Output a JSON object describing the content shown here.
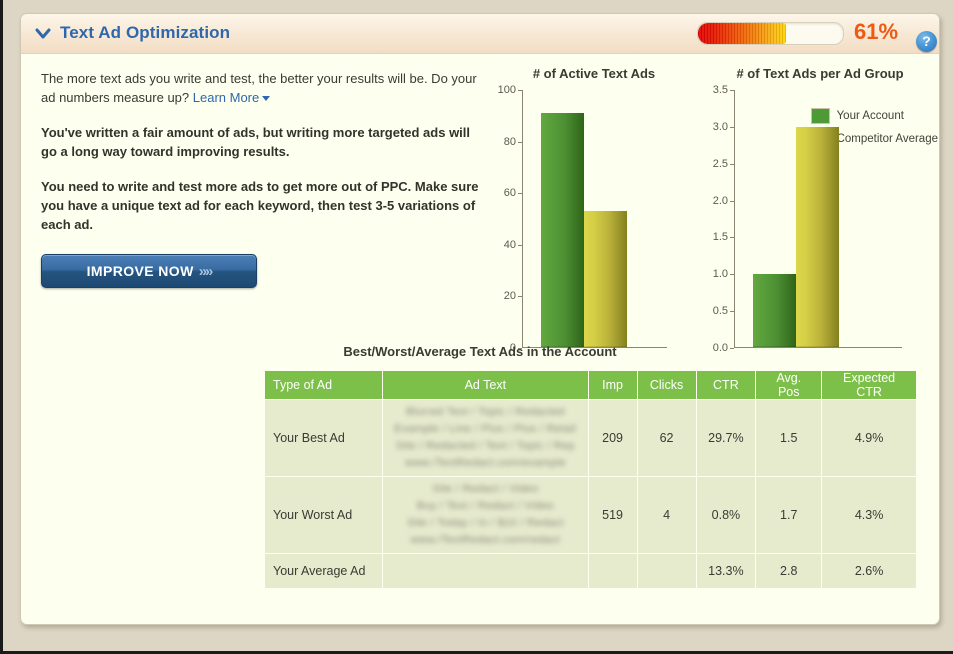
{
  "header": {
    "title": "Text Ad Optimization",
    "progress_value": 61,
    "progress_label": "61%",
    "help_glyph": "?",
    "collapse_icon": "chevron-down-icon"
  },
  "intro": {
    "text_before_link": "The more text ads you write and test, the better your results will be. Do your ad numbers measure up? ",
    "link_label": "Learn More"
  },
  "advice": {
    "paragraph_1": "You've written a fair amount of ads, but writing more targeted ads will go a long way toward improving results.",
    "paragraph_2": "You need to write and test more ads to get more out of PPC. Make sure you have a unique text ad for each keyword, then test 3-5 variations of each ad."
  },
  "cta": {
    "label": "IMPROVE NOW",
    "arrows": "»»"
  },
  "legend": {
    "your_account": "Your Account",
    "competitor_average": "Competitor Average",
    "your_account_color": "#4e9a36",
    "competitor_average_color": "#e6e13c"
  },
  "table": {
    "title": "Best/Worst/Average Text Ads in the Account",
    "columns": [
      "Type of Ad",
      "Ad Text",
      "Imp",
      "Clicks",
      "CTR",
      "Avg. Pos",
      "Expected CTR"
    ],
    "rows": [
      {
        "type": "Your Best Ad",
        "ad_text": "Blurred Text / Topic / Redacted\nExample / Line / Plus / Plus / Retail\nSite / Redacted / Text / Topic / Rep\nwww./TextRedact.com/example",
        "imp": "209",
        "clicks": "62",
        "ctr": "29.7%",
        "avg_pos": "1.5",
        "expected_ctr": "4.9%"
      },
      {
        "type": "Your Worst Ad",
        "ad_text": "Site / Redact / Video\nBuy / Text / Redact / Video\nSite / Today / In / $10 / Redact\nwww./TextRedact.com/redact",
        "imp": "519",
        "clicks": "4",
        "ctr": "0.8%",
        "avg_pos": "1.7",
        "expected_ctr": "4.3%"
      },
      {
        "type": "Your Average Ad",
        "ad_text": "",
        "imp": "",
        "clicks": "",
        "ctr": "13.3%",
        "avg_pos": "2.8",
        "expected_ctr": "2.6%"
      }
    ]
  },
  "chart_data": [
    {
      "type": "bar",
      "title": "# of Active Text Ads",
      "categories": [
        "Your Account",
        "Competitor Average"
      ],
      "values": [
        91,
        53
      ],
      "series": [
        {
          "name": "Your Account",
          "values": [
            91
          ],
          "color": "#4e9a36"
        },
        {
          "name": "Competitor Average",
          "values": [
            53
          ],
          "color": "#c9c23f"
        }
      ],
      "xlabel": "",
      "ylabel": "",
      "ylim": [
        0,
        100
      ],
      "yticks": [
        0,
        20,
        40,
        60,
        80,
        100
      ],
      "ytick_labels": [
        "0",
        "20",
        "40",
        "60",
        "80",
        "100"
      ],
      "grid": false,
      "legend": "none"
    },
    {
      "type": "bar",
      "title": "# of Text Ads per Ad Group",
      "categories": [
        "Your Account",
        "Competitor Average"
      ],
      "values": [
        1.0,
        3.0
      ],
      "series": [
        {
          "name": "Your Account",
          "values": [
            1.0
          ],
          "color": "#4e9a36"
        },
        {
          "name": "Competitor Average",
          "values": [
            3.0
          ],
          "color": "#c9c23f"
        }
      ],
      "xlabel": "",
      "ylabel": "",
      "ylim": [
        0,
        3.5
      ],
      "yticks": [
        0.0,
        0.5,
        1.0,
        1.5,
        2.0,
        2.5,
        3.0,
        3.5
      ],
      "ytick_labels": [
        "0.0",
        "0.5",
        "1.0",
        "1.5",
        "2.0",
        "2.5",
        "3.0",
        "3.5"
      ],
      "grid": false,
      "legend": "top-right"
    }
  ]
}
